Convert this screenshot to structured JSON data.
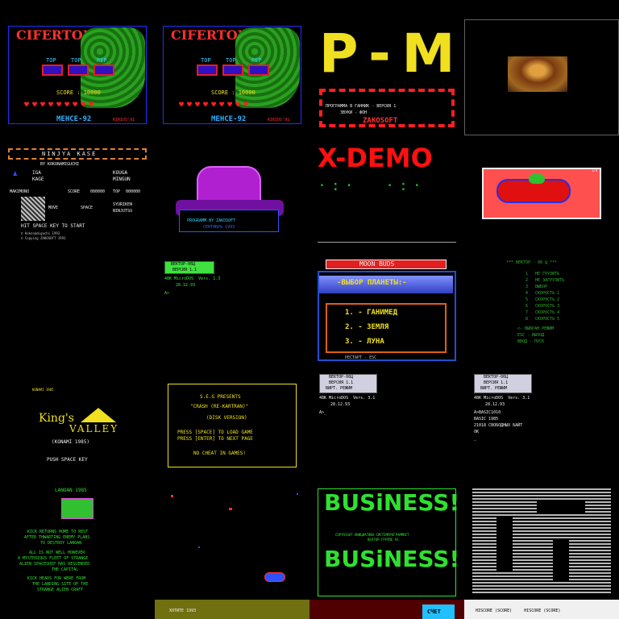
{
  "tiles": {
    "ciferton1": {
      "title": "CIFERTON",
      "l1": "TOP",
      "l2": "TOP",
      "l3": "REP",
      "score": "SCORE : 10000",
      "footer": "MEHCE-92",
      "credit": "KIRIUS'91"
    },
    "ciferton2": {
      "title": "CIFERTON",
      "l1": "TOP",
      "l2": "TOP",
      "l3": "REP",
      "score": "SCORE : 10000",
      "footer": "MEHCE-92",
      "credit": "KIRIUS'91"
    },
    "pm": {
      "big": "P-M",
      "line1": "ПРОГРАММА В ГАННИК - ВЕРСИЯ 1",
      "line2": "ЗВУКИ - ФОН",
      "brand": "ZAKOSOFT"
    },
    "monalisa": {},
    "ninja": {
      "title": "NINJYA KASE",
      "by": "BY KOKONAMIGUCHI",
      "r1": "IGA",
      "r1b": "KOUGA",
      "r2": "KAGE",
      "r2b": "MINGUN",
      "r3a": "MAKIMONO",
      "r3b": "SCORE",
      "r3c": "000000",
      "r3d": "TOP",
      "r3e": "000000",
      "move": "MOVE",
      "space": "SPACE",
      "shuriken": "SYURIKEN",
      "ninjutsu": "NINJUTSU",
      "hit": "HIT SPACE KEY TO START",
      "c1": "© Kokonamiguchi 1993",
      "c2": "© Copying ZAKOSOFT 1993"
    },
    "totem": {
      "l1": "PROGRAMM BY ZAKOSOFT",
      "l2": "СЕНТЯБРЬ 1993"
    },
    "xdemo": {
      "title": "X-DEMO"
    },
    "racecar": {
      "corner": "1/4"
    },
    "vector1": {
      "l1": "ВЕКТОР-06Ц",
      "l2": "ВЕРСИЯ 1.1",
      "l3": "48K MicroDOS  Vers. 1.3",
      "l4": "28.12.93",
      "l5": "A>"
    },
    "moonbuds": {
      "title": "MOON BUDS",
      "choose": "-ВЫБОР ПЛАНЕТЫ:-",
      "p1": "1. - ГАНИМЕД",
      "p2": "2. - ЗЕМЛЯ",
      "p3": "3. - ЛУНА",
      "foot": "РЕСТАРТ - ESC"
    },
    "menu": {
      "h": "*** ВЕКТОР - 06 Ц ***",
      "i1": "1   НЕ ГРУЗИТЬ",
      "i2": "2   НЕ ЗАГРУЗИТЬ",
      "i3": "3   ВЫБОР",
      "i4": "4   СКОРОСТЬ 1",
      "i5": "5   СКОРОСТЬ 2",
      "i6": "6   СКОРОСТЬ 3",
      "i7": "7   СКОРОСТЬ 4",
      "i8": "8   СКОРОСТЬ 5",
      "f1": "<- ВЫБРАН РЕЖИМ",
      "f2": "ESC - ВЫХОД",
      "f3": "ВВОД - ПУСК"
    },
    "kings": {
      "top": "KONAMI 1985",
      "title1": "King's",
      "title2": "VALLEY",
      "konami": "(KONAMI 1985)",
      "push": "PUSH SPACE KEY"
    },
    "crash": {
      "l1": "S.E.G PRESENTS",
      "l2": "\"CRASH (RE-KARTRAN)\"",
      "l3": "(DISK VERSION)",
      "l4": "PRESS [SPACE] TO LOAD GAME",
      "l5": "PRESS [ENTER] TO NEXT PAGE",
      "l6": "NO CHEAT IN GAMES!"
    },
    "vector2": {
      "l1": "ВЕКТОР-06Ц",
      "l2": "ВЕРСИЯ 1.1",
      "l3": "ВИРТ. РЕЖИМ",
      "l4": "48K MicroDOS  Vers. 3.1",
      "l5": "28.12.93",
      "l6": "A>_"
    },
    "vector3": {
      "l1": "ВЕКТОР-06Ц",
      "l2": "ВЕРСИЯ 1.1",
      "l3": "ВИРТ. РЕЖИМ",
      "l4": "48K MicroDOS  Vers. 3.1",
      "l5": "28.12.93",
      "l6": "A>BASIC1010",
      "l7": "BASIC 1985",
      "l8": "21018 СВОБОДНЫХ БАЙТ",
      "l9": "OK",
      "l10": "_"
    },
    "lanoan": {
      "title": "LANOAN 1985",
      "t1": "KICK RETURNS HOME TO REST",
      "t2": "AFTER THWARTING ENEMY PLANS",
      "t3": "TO DESTROY LANOAN",
      "t4": "ALL IS NOT WELL HOWEVER",
      "t5": "A MYSTERIOUS FLEET OF STRANGE",
      "t6": "ALIEN SPACESHIP HAS DESCENDED",
      "t7": "THE CAPITAL",
      "t8": "KICK HEADS FOR WERE FROM",
      "t9": "THE LANDING SITE OF THE",
      "t10": "STRANGE ALIEN CRAFT"
    },
    "space": {},
    "business": {
      "w1": "BUSiNESS!",
      "copy1": "COPYRIGHT ИНИЦИАТИВА СИСТЕМПРОГРАММИСТ",
      "copy2": "ВЕКТОР-ГРУППЕ 93",
      "w2": "BUSiNESS!"
    },
    "maze": {}
  },
  "bottom_strip": {
    "b1": "ХОТИТЕ 1993",
    "b2": "СЧЕТ",
    "b3": "HISCORE (SCORE)     HISCORE (SCORE)"
  },
  "colors": {
    "green": "#30e030",
    "red": "#ff2020",
    "blue": "#2040ff",
    "yellow": "#f0e020",
    "white": "#f0f0f0"
  }
}
